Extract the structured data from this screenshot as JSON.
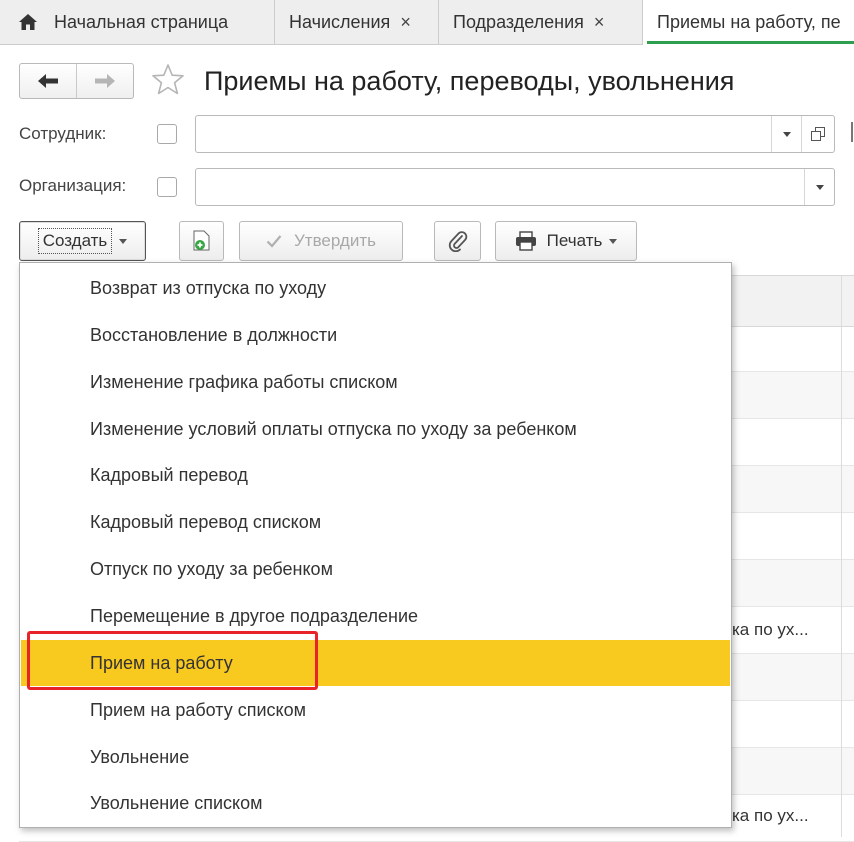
{
  "tabs": [
    {
      "label": "Начальная страница",
      "closable": false,
      "icon": "home-icon"
    },
    {
      "label": "Начисления",
      "closable": true
    },
    {
      "label": "Подразделения",
      "closable": true
    },
    {
      "label": "Приемы на работу, пе",
      "closable": false,
      "active": true
    }
  ],
  "close_glyph": "×",
  "title": "Приемы на работу, переводы, увольнения",
  "filters": {
    "employee_label": "Сотрудник:",
    "organization_label": "Организация:"
  },
  "toolbar": {
    "create_label": "Создать",
    "approve_label": "Утвердить",
    "print_label": "Печать"
  },
  "table": {
    "visible_cells": [
      {
        "row": 7,
        "text": "ка по ух..."
      },
      {
        "row": 11,
        "text": "ка по ух..."
      }
    ]
  },
  "create_menu": {
    "items": [
      "Возврат из отпуска по уходу",
      "Восстановление в должности",
      "Изменение графика работы списком",
      "Изменение условий оплаты отпуска по уходу за ребенком",
      "Кадровый перевод",
      "Кадровый перевод списком",
      "Отпуск по уходу за ребенком",
      "Перемещение в другое подразделение",
      "Прием на работу",
      "Прием на работу списком",
      "Увольнение",
      "Увольнение списком"
    ],
    "selected_index": 8
  },
  "colors": {
    "selected_item": "#f8c91f",
    "highlight_border": "#e8232a",
    "active_tab_underline": "#2e9e4f",
    "add_icon_green": "#3aa645"
  }
}
